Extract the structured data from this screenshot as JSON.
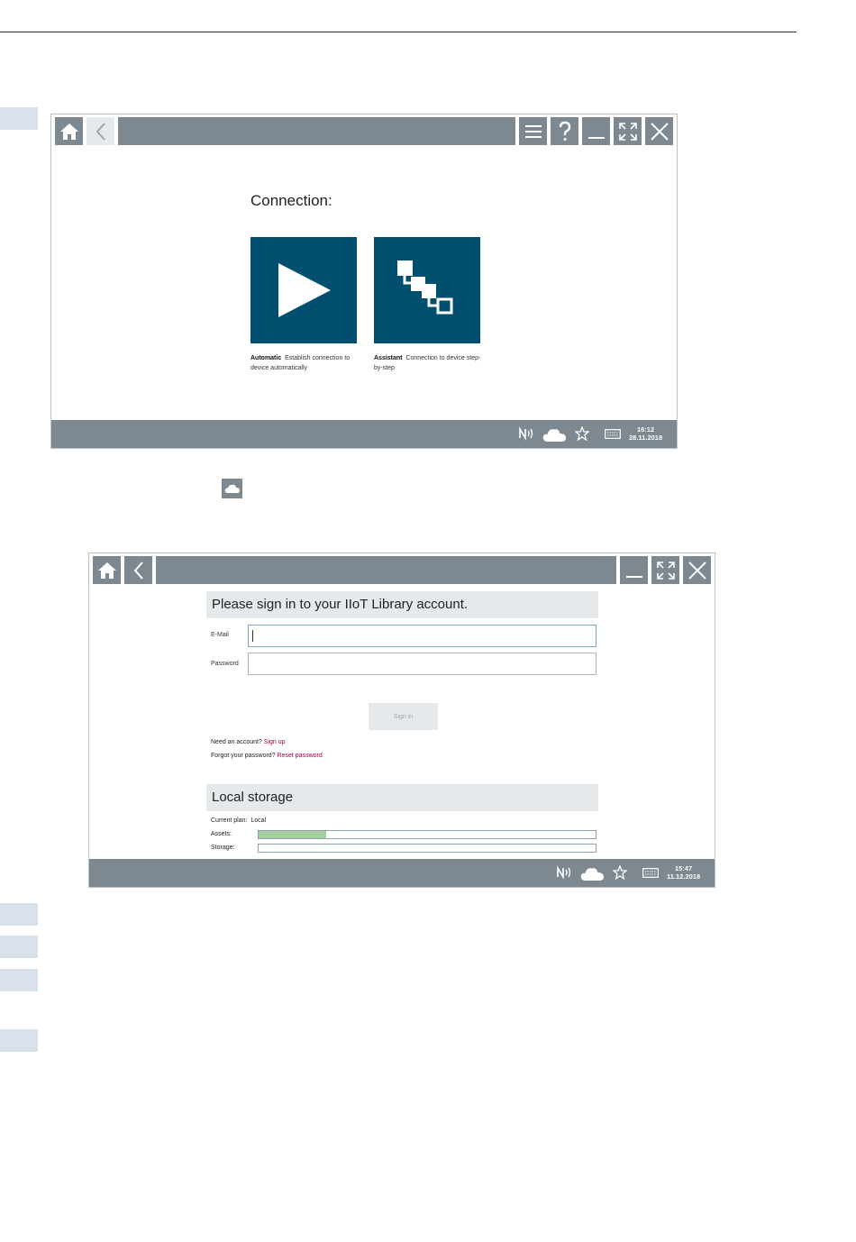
{
  "screen1": {
    "heading": "Connection:",
    "tiles": [
      {
        "bold": "Automatic",
        "text": "Establish connection to device automatically",
        "icon": "play-icon"
      },
      {
        "bold": "Assistant",
        "text": "Connection to device step-by-step",
        "icon": "network-tree-icon"
      }
    ],
    "status": {
      "time": "16:12",
      "date": "28.11.2018"
    }
  },
  "screen2": {
    "signin_title": "Please sign in to your IIoT Library account.",
    "email_label": "E-Mail",
    "password_label": "Password",
    "signin_button": "Sign in",
    "need_account": "Need an account?",
    "signup_link": "Sign up",
    "forgot": "Forgot your password?",
    "reset_link": "Reset password",
    "local_storage_title": "Local storage",
    "current_plan_label": "Current plan:",
    "current_plan_value": "Local",
    "assets_label": "Assets:",
    "storage_label": "Storage:",
    "assets_fraction": 0.2,
    "storage_fraction": 0.0,
    "status": {
      "time": "15:47",
      "date": "11.12.2018"
    }
  },
  "colors": {
    "tile": "#004f6e",
    "bar": "#7d8891",
    "link": "#a3004d",
    "progress": "#a2cf9b"
  }
}
